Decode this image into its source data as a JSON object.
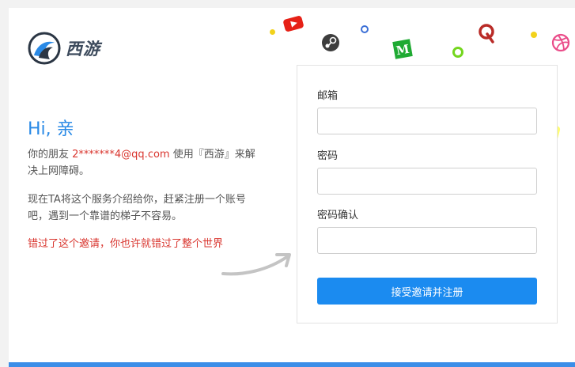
{
  "brand": {
    "name": "西游"
  },
  "intro": {
    "greeting": "Hi, 亲",
    "line1_before": "你的朋友 ",
    "inviter_email": "2*******4@qq.com",
    "line1_after": " 使用『西游』来解决上网障碍。",
    "line2": "现在TA将这个服务介绍给你，赶紧注册一个账号吧，遇到一个靠谱的梯子不容易。",
    "warning": "错过了这个邀请，你也许就错过了整个世界"
  },
  "form": {
    "email_label": "邮箱",
    "email_value": "",
    "password_label": "密码",
    "password_value": "",
    "confirm_label": "密码确认",
    "confirm_value": "",
    "submit_label": "接受邀请并注册"
  },
  "icons": [
    "youtube-icon",
    "steam-icon",
    "medium-icon",
    "quora-icon",
    "dribbble-icon",
    "spotify-icon",
    "google-icon",
    "snapchat-icon"
  ],
  "colors": {
    "accent": "#1b8bf0",
    "greeting": "#2a8ae6",
    "warning": "#d9362f",
    "bottom_bar": "#3b8ee8"
  }
}
